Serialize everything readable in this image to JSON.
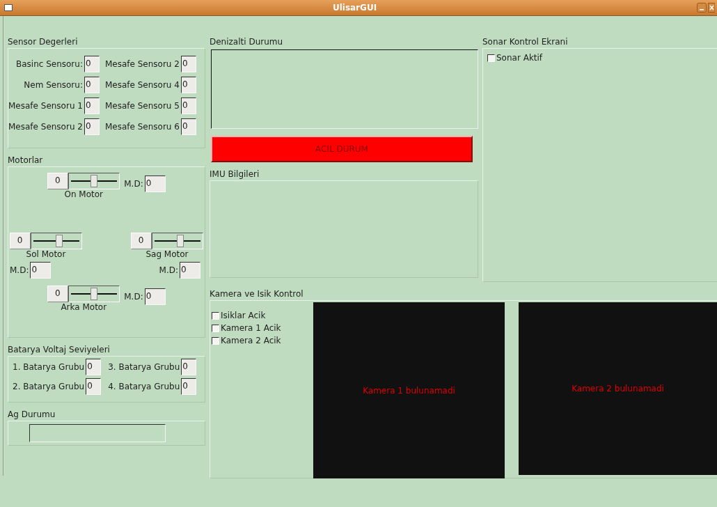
{
  "window": {
    "title": "UlisarGUI"
  },
  "sensors": {
    "title": "Sensor Degerleri",
    "fields": [
      {
        "label": "Basinc Sensoru:",
        "value": "0"
      },
      {
        "label": "Mesafe Sensoru 2",
        "value": "0"
      },
      {
        "label": "Nem Sensoru:",
        "value": "0"
      },
      {
        "label": "Mesafe Sensoru 4",
        "value": "0"
      },
      {
        "label": "Mesafe Sensoru 1",
        "value": "0"
      },
      {
        "label": "Mesafe Sensoru 5",
        "value": "0"
      },
      {
        "label": "Mesafe Sensoru 2",
        "value": "0"
      },
      {
        "label": "Mesafe Sensoru 6",
        "value": "0"
      }
    ]
  },
  "motors": {
    "title": "Motorlar",
    "items": [
      {
        "kind": "inline",
        "name": "On Motor",
        "value": "0",
        "level": 0.5,
        "md_label": "M.D:",
        "md_value": "0"
      },
      {
        "kind": "below-left",
        "name": "Sol Motor",
        "value": "0",
        "level": 0.55,
        "md_label": "M.D:",
        "md_value": "0"
      },
      {
        "kind": "below-right",
        "name": "Sag Motor",
        "value": "0",
        "level": 0.55,
        "md_label": "M.D:",
        "md_value": "0"
      },
      {
        "kind": "inline",
        "name": "Arka Motor",
        "value": "0",
        "level": 0.5,
        "md_label": "M.D:",
        "md_value": "0"
      }
    ]
  },
  "battery": {
    "title": "Batarya Voltaj Seviyeleri",
    "fields": [
      {
        "label": "1. Batarya Grubu",
        "value": "0"
      },
      {
        "label": "3. Batarya Grubu",
        "value": "0"
      },
      {
        "label": "2. Batarya Grubu",
        "value": "0"
      },
      {
        "label": "4. Batarya Grubu",
        "value": "0"
      }
    ]
  },
  "network": {
    "title": "Ag Durumu"
  },
  "status": {
    "title": "Denizalti Durumu",
    "emergency_button": "ACIL DURUM"
  },
  "imu": {
    "title": "IMU Bilgileri"
  },
  "sonar": {
    "title": "Sonar Kontrol Ekrani",
    "checkbox": {
      "label": "Sonar Aktif",
      "checked": false
    }
  },
  "camera": {
    "title": "Kamera ve Isik Kontrol",
    "checkboxes": [
      {
        "label": "Isiklar Acik",
        "checked": false
      },
      {
        "label": "Kamera 1 Acik",
        "checked": false
      },
      {
        "label": "Kamera 2 Acik",
        "checked": false
      }
    ],
    "views": [
      {
        "message": "Kamera 1 bulunamadi"
      },
      {
        "message": "Kamera 2 bulunamadi"
      }
    ]
  }
}
